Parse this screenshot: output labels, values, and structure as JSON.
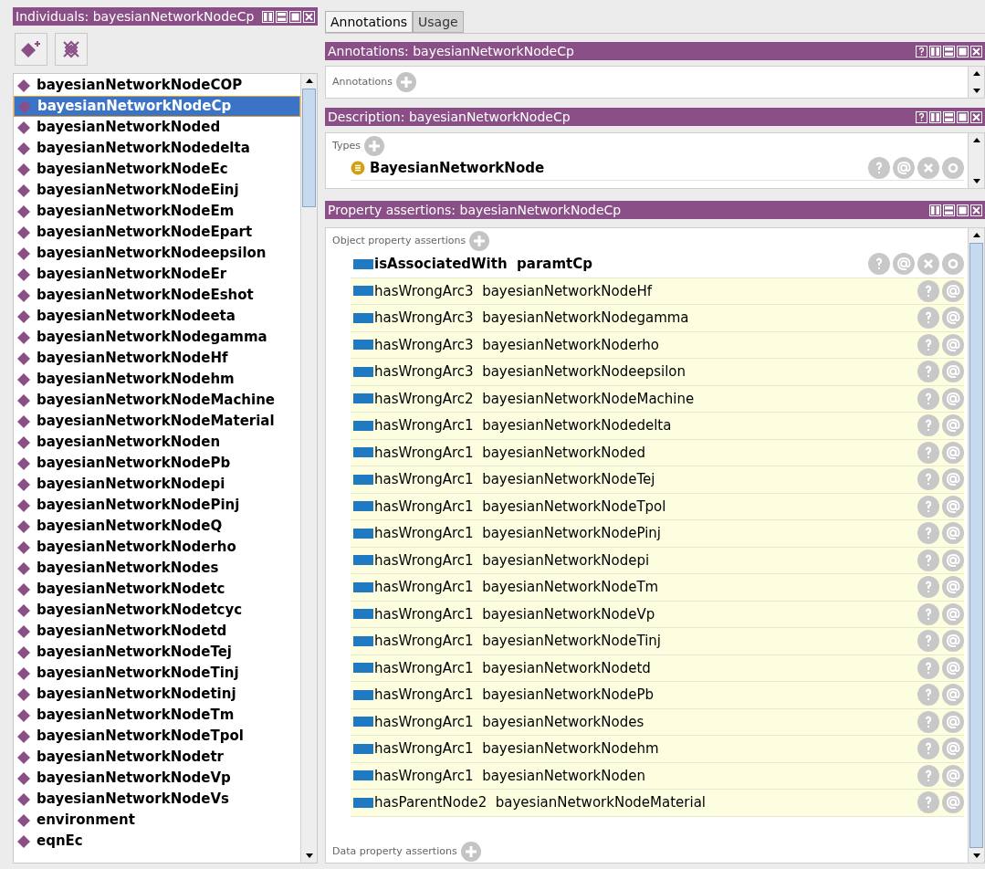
{
  "individuals": {
    "title": "Individuals: bayesianNetworkNodeCp",
    "items": [
      {
        "label": "bayesianNetworkNodeCOP",
        "selected": false
      },
      {
        "label": "bayesianNetworkNodeCp",
        "selected": true
      },
      {
        "label": "bayesianNetworkNoded",
        "selected": false
      },
      {
        "label": "bayesianNetworkNodedelta",
        "selected": false
      },
      {
        "label": "bayesianNetworkNodeEc",
        "selected": false
      },
      {
        "label": "bayesianNetworkNodeEinj",
        "selected": false
      },
      {
        "label": "bayesianNetworkNodeEm",
        "selected": false
      },
      {
        "label": "bayesianNetworkNodeEpart",
        "selected": false
      },
      {
        "label": "bayesianNetworkNodeepsilon",
        "selected": false
      },
      {
        "label": "bayesianNetworkNodeEr",
        "selected": false
      },
      {
        "label": "bayesianNetworkNodeEshot",
        "selected": false
      },
      {
        "label": "bayesianNetworkNodeeta",
        "selected": false
      },
      {
        "label": "bayesianNetworkNodegamma",
        "selected": false
      },
      {
        "label": "bayesianNetworkNodeHf",
        "selected": false
      },
      {
        "label": "bayesianNetworkNodehm",
        "selected": false
      },
      {
        "label": "bayesianNetworkNodeMachine",
        "selected": false
      },
      {
        "label": "bayesianNetworkNodeMaterial",
        "selected": false
      },
      {
        "label": "bayesianNetworkNoden",
        "selected": false
      },
      {
        "label": "bayesianNetworkNodePb",
        "selected": false
      },
      {
        "label": "bayesianNetworkNodepi",
        "selected": false
      },
      {
        "label": "bayesianNetworkNodePinj",
        "selected": false
      },
      {
        "label": "bayesianNetworkNodeQ",
        "selected": false
      },
      {
        "label": "bayesianNetworkNoderho",
        "selected": false
      },
      {
        "label": "bayesianNetworkNodes",
        "selected": false
      },
      {
        "label": "bayesianNetworkNodetc",
        "selected": false
      },
      {
        "label": "bayesianNetworkNodetcyc",
        "selected": false
      },
      {
        "label": "bayesianNetworkNodetd",
        "selected": false
      },
      {
        "label": "bayesianNetworkNodeTej",
        "selected": false
      },
      {
        "label": "bayesianNetworkNodeTinj",
        "selected": false
      },
      {
        "label": "bayesianNetworkNodetinj",
        "selected": false
      },
      {
        "label": "bayesianNetworkNodeTm",
        "selected": false
      },
      {
        "label": "bayesianNetworkNodeTpol",
        "selected": false
      },
      {
        "label": "bayesianNetworkNodetr",
        "selected": false
      },
      {
        "label": "bayesianNetworkNodeVp",
        "selected": false
      },
      {
        "label": "bayesianNetworkNodeVs",
        "selected": false
      },
      {
        "label": "environment",
        "selected": false
      },
      {
        "label": "eqnEc",
        "selected": false
      }
    ]
  },
  "tabs": [
    {
      "label": "Annotations",
      "selected": true
    },
    {
      "label": "Usage",
      "selected": false
    }
  ],
  "annotations": {
    "title": "Annotations: bayesianNetworkNodeCp",
    "section": "Annotations"
  },
  "description": {
    "title": "Description: bayesianNetworkNodeCp",
    "section": "Types",
    "types": [
      "BayesianNetworkNode"
    ]
  },
  "property_assertions": {
    "title": "Property assertions: bayesianNetworkNodeCp",
    "object_section": "Object property assertions",
    "data_section": "Data property assertions",
    "rows": [
      {
        "kind": "asserted",
        "property": "isAssociatedWith",
        "value": "paramtCp"
      },
      {
        "kind": "inferred",
        "property": "hasWrongArc3",
        "value": "bayesianNetworkNodeHf"
      },
      {
        "kind": "inferred",
        "property": "hasWrongArc3",
        "value": "bayesianNetworkNodegamma"
      },
      {
        "kind": "inferred",
        "property": "hasWrongArc3",
        "value": "bayesianNetworkNoderho"
      },
      {
        "kind": "inferred",
        "property": "hasWrongArc3",
        "value": "bayesianNetworkNodeepsilon"
      },
      {
        "kind": "inferred",
        "property": "hasWrongArc2",
        "value": "bayesianNetworkNodeMachine"
      },
      {
        "kind": "inferred",
        "property": "hasWrongArc1",
        "value": "bayesianNetworkNodedelta"
      },
      {
        "kind": "inferred",
        "property": "hasWrongArc1",
        "value": "bayesianNetworkNoded"
      },
      {
        "kind": "inferred",
        "property": "hasWrongArc1",
        "value": "bayesianNetworkNodeTej"
      },
      {
        "kind": "inferred",
        "property": "hasWrongArc1",
        "value": "bayesianNetworkNodeTpol"
      },
      {
        "kind": "inferred",
        "property": "hasWrongArc1",
        "value": "bayesianNetworkNodePinj"
      },
      {
        "kind": "inferred",
        "property": "hasWrongArc1",
        "value": "bayesianNetworkNodepi"
      },
      {
        "kind": "inferred",
        "property": "hasWrongArc1",
        "value": "bayesianNetworkNodeTm"
      },
      {
        "kind": "inferred",
        "property": "hasWrongArc1",
        "value": "bayesianNetworkNodeVp"
      },
      {
        "kind": "inferred",
        "property": "hasWrongArc1",
        "value": "bayesianNetworkNodeTinj"
      },
      {
        "kind": "inferred",
        "property": "hasWrongArc1",
        "value": "bayesianNetworkNodetd"
      },
      {
        "kind": "inferred",
        "property": "hasWrongArc1",
        "value": "bayesianNetworkNodePb"
      },
      {
        "kind": "inferred",
        "property": "hasWrongArc1",
        "value": "bayesianNetworkNodes"
      },
      {
        "kind": "inferred",
        "property": "hasWrongArc1",
        "value": "bayesianNetworkNodehm"
      },
      {
        "kind": "inferred",
        "property": "hasWrongArc1",
        "value": "bayesianNetworkNoden"
      },
      {
        "kind": "inferred",
        "property": "hasParentNode2",
        "value": "bayesianNetworkNodeMaterial"
      }
    ]
  }
}
